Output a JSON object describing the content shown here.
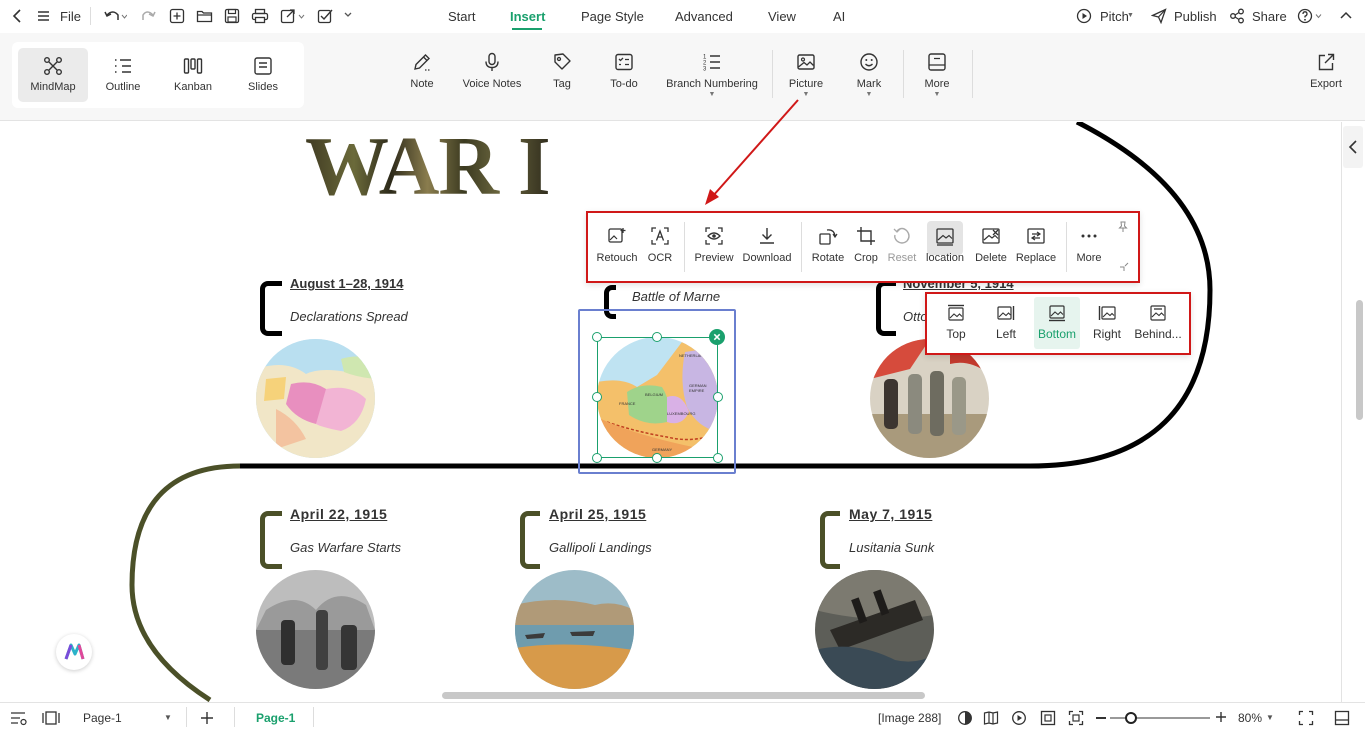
{
  "menubar": {
    "file": "File",
    "tabs": [
      "Start",
      "Insert",
      "Page Style",
      "Advanced",
      "View",
      "AI"
    ],
    "active_tab": "Insert",
    "pitch": "Pitch",
    "publish": "Publish",
    "share": "Share"
  },
  "views": [
    {
      "label": "MindMap",
      "icon": "mindmap-icon",
      "selected": true
    },
    {
      "label": "Outline",
      "icon": "outline-icon"
    },
    {
      "label": "Kanban",
      "icon": "kanban-icon"
    },
    {
      "label": "Slides",
      "icon": "slides-icon"
    }
  ],
  "toolbar": {
    "note": "Note",
    "voice_notes": "Voice Notes",
    "tag": "Tag",
    "todo": "To-do",
    "branch_numbering": "Branch Numbering",
    "picture": "Picture",
    "mark": "Mark",
    "more": "More",
    "export": "Export"
  },
  "canvas": {
    "title": "WAR I",
    "topics": [
      {
        "date": "August 1–28, 1914",
        "desc": "Declarations Spread"
      },
      {
        "date": "",
        "desc": "Battle of Marne"
      },
      {
        "date": "November 5, 1914",
        "desc": "Otto"
      },
      {
        "date": "April 22, 1915",
        "desc": "Gas Warfare Starts"
      },
      {
        "date": "April 25, 1915",
        "desc": "Gallipoli Landings"
      },
      {
        "date": "May 7, 1915",
        "desc": "Lusitania Sunk"
      }
    ],
    "map_labels": [
      "NETHERLANDS",
      "BELGIUM",
      "GERMAN EMPIRE",
      "FRANCE",
      "LUXEMBOURG",
      "GERMANY"
    ]
  },
  "picture_toolbar": {
    "items": [
      "Retouch",
      "OCR",
      "Preview",
      "Download",
      "Rotate",
      "Crop",
      "Reset",
      "location",
      "Delete",
      "Replace",
      "More"
    ]
  },
  "location_menu": {
    "items": [
      "Top",
      "Left",
      "Bottom",
      "Right",
      "Behind..."
    ],
    "selected": "Bottom"
  },
  "statusbar": {
    "page_select": "Page-1",
    "page_tab": "Page-1",
    "image_info": "[Image 288]",
    "zoom": "80%",
    "zoom_level": 0.8
  },
  "colors": {
    "accent": "#1aa06d",
    "highlight": "#d01818",
    "olive": "#4b5028",
    "selection": "#6a7fcf"
  }
}
